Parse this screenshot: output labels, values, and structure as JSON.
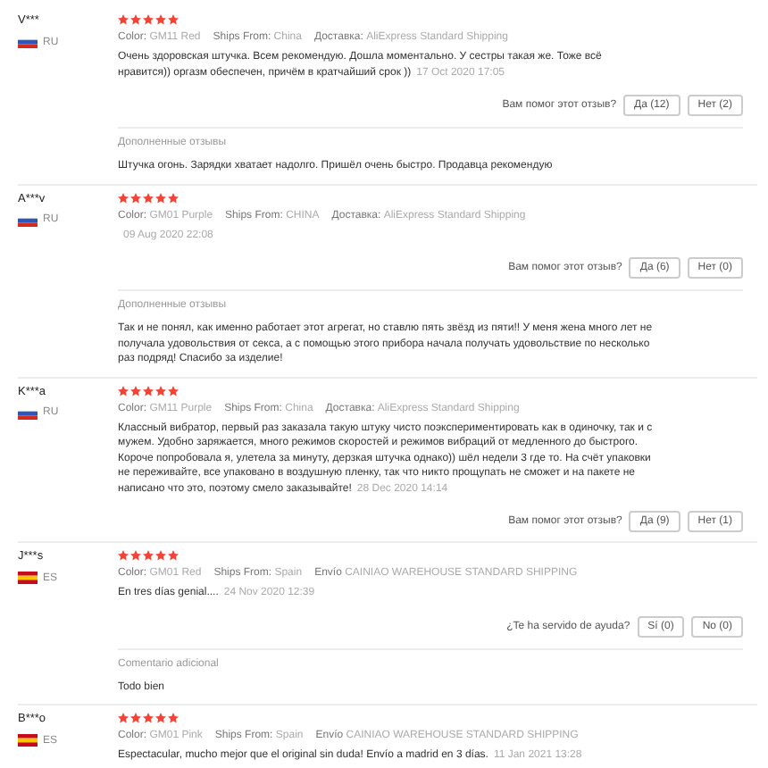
{
  "reviews": [
    {
      "user": "V***",
      "flag": {
        "kind": "ru"
      },
      "country": "RU",
      "stars": 5,
      "meta": [
        {
          "label": "Color:",
          "value": "GM11 Red"
        },
        {
          "label": "Ships From:",
          "value": "China"
        },
        {
          "label": "Доставка:",
          "value": "AliExpress Standard Shipping"
        }
      ],
      "text": "Очень здоровская штучка. Всем рекомендую. Дошла моментально. У сестры такая же. Тоже всё нравится)) оргазм обеспечен, причём в кратчайший срок ))",
      "date": "17 Oct 2020 17:05",
      "helpful": {
        "question": "Вам помог этот отзыв?",
        "yes": "Да (12)",
        "no": "Нет (2)"
      },
      "additional": {
        "heading": "Дополненные отзывы",
        "text": "Штучка огонь. Зарядки хватает надолго. Пришёл очень быстро. Продавца рекомендую"
      }
    },
    {
      "user": "A***v",
      "flag": {
        "kind": "ru"
      },
      "country": "RU",
      "stars": 5,
      "meta": [
        {
          "label": "Color:",
          "value": "GM01 Purple"
        },
        {
          "label": "Ships From:",
          "value": "CHINA"
        },
        {
          "label": "Доставка:",
          "value": "AliExpress Standard Shipping"
        }
      ],
      "date": "09 Aug 2020 22:08",
      "helpful": {
        "question": "Вам помог этот отзыв?",
        "yes": "Да (6)",
        "no": "Нет (0)"
      },
      "additional": {
        "heading": "Дополненные отзывы",
        "text": "Так и не понял, как именно работает этот агрегат, но ставлю пять звёзд из пяти!! У меня жена много лет не получала удовольствия от секса, а с помощью этого прибора начала получать удовольствие по несколько раз подряд! Спасибо за изделие!"
      }
    },
    {
      "user": "K***a",
      "flag": {
        "kind": "ru"
      },
      "country": "RU",
      "stars": 5,
      "meta": [
        {
          "label": "Color:",
          "value": "GM11 Purple"
        },
        {
          "label": "Ships From:",
          "value": "China"
        },
        {
          "label": "Доставка:",
          "value": "AliExpress Standard Shipping"
        }
      ],
      "text": "Классный вибратор, первый раз заказала такую штуку чисто поэкспериментировать как в одиночку, так и с мужем. Удобно заряжается, много режимов скоростей и режимов вибраций от медленного до быстрого. Короче попробовала я, улетела за минуту, дерзкая штучка однако)) шёл недели 3 где то. На счёт упаковки не переживайте, все упаковано в воздушную пленку, так что никто прощупать не сможет и на пакете не написано что это, поэтому смело заказывайте!",
      "date": "28 Dec 2020 14:14",
      "helpful": {
        "question": "Вам помог этот отзыв?",
        "yes": "Да (9)",
        "no": "Нет (1)"
      }
    },
    {
      "user": "J***s",
      "flag": {
        "kind": "es"
      },
      "country": "ES",
      "stars": 5,
      "meta": [
        {
          "label": "Color:",
          "value": "GM01 Red"
        },
        {
          "label": "Ships From:",
          "value": "Spain"
        },
        {
          "label": "Envío",
          "value": "CAINIAO WAREHOUSE STANDARD SHIPPING"
        }
      ],
      "text": "En tres días genial....",
      "date": "24 Nov 2020 12:39",
      "helpful": {
        "question": "¿Te ha servido de ayuda?",
        "yes": "Sí (0)",
        "no": "No (0)"
      },
      "additional": {
        "heading": "Comentario adicional",
        "text": "Todo bien"
      }
    },
    {
      "user": "B***o",
      "flag": {
        "kind": "es"
      },
      "country": "ES",
      "stars": 5,
      "meta": [
        {
          "label": "Color:",
          "value": "GM01 Pink"
        },
        {
          "label": "Ships From:",
          "value": "Spain"
        },
        {
          "label": "Envío",
          "value": "CAINIAO WAREHOUSE STANDARD SHIPPING"
        }
      ],
      "text": "Espectacular, mucho mejor que el original sin duda! Envío a madrid en 3 días.",
      "date": "11 Jan 2021 13:28"
    }
  ]
}
